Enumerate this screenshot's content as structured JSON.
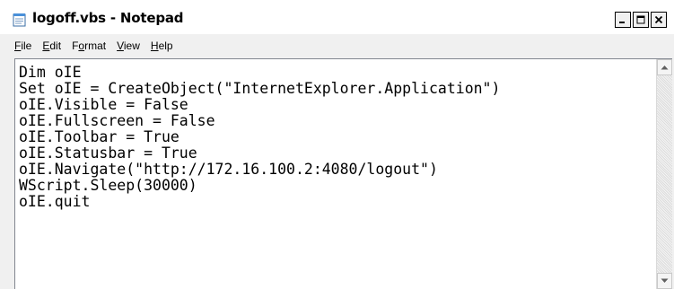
{
  "window": {
    "title": "logoff.vbs - Notepad",
    "icon": "notepad-icon"
  },
  "controls": {
    "minimize_icon": "minimize-icon",
    "maximize_icon": "maximize-icon",
    "close_icon": "close-icon"
  },
  "menu": {
    "file": {
      "accel": "F",
      "rest": "ile"
    },
    "edit": {
      "accel": "E",
      "rest": "dit"
    },
    "format": {
      "pre": "F",
      "accel": "o",
      "rest": "rmat"
    },
    "view": {
      "accel": "V",
      "rest": "iew"
    },
    "help": {
      "accel": "H",
      "rest": "elp"
    }
  },
  "editor": {
    "content": "Dim oIE\nSet oIE = CreateObject(\"InternetExplorer.Application\")\noIE.Visible = False\noIE.Fullscreen = False\noIE.Toolbar = True\noIE.Statusbar = True\noIE.Navigate(\"http://172.16.100.2:4080/logout\")\nWScript.Sleep(30000)\noIE.quit"
  },
  "scrollbar": {
    "up_icon": "scroll-up-arrow-icon",
    "down_icon": "scroll-down-arrow-icon"
  }
}
